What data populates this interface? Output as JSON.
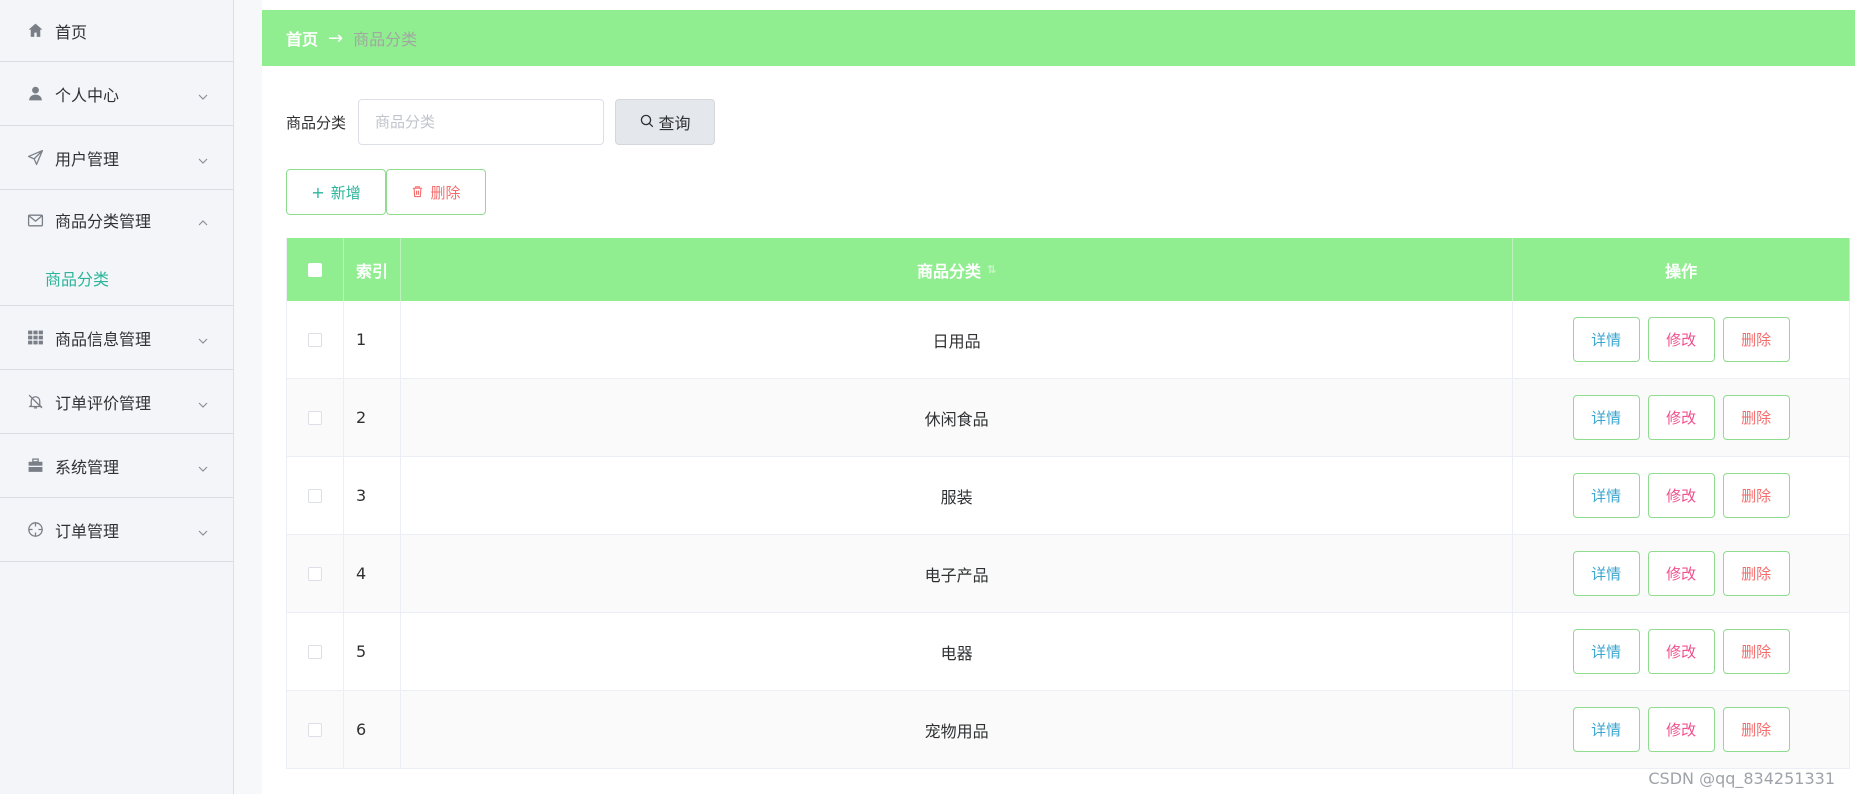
{
  "sidebar": {
    "items": [
      {
        "label": "首页",
        "icon": "home-icon"
      },
      {
        "label": "个人中心",
        "icon": "user-icon"
      },
      {
        "label": "用户管理",
        "icon": "send-icon"
      },
      {
        "label": "商品分类管理",
        "icon": "mail-icon",
        "expanded": true,
        "children": [
          {
            "label": "商品分类",
            "active": true
          }
        ]
      },
      {
        "label": "商品信息管理",
        "icon": "grid-icon"
      },
      {
        "label": "订单评价管理",
        "icon": "bell-off-icon"
      },
      {
        "label": "系统管理",
        "icon": "briefcase-icon"
      },
      {
        "label": "订单管理",
        "icon": "target-icon"
      }
    ]
  },
  "breadcrumb": {
    "home": "首页",
    "separator": "→",
    "current": "商品分类"
  },
  "search": {
    "label": "商品分类",
    "placeholder": "商品分类",
    "value": "",
    "button_label": "查询"
  },
  "actions": {
    "add_label": "新增",
    "delete_label": "删除"
  },
  "table": {
    "columns": {
      "index": "索引",
      "name": "商品分类",
      "ops": "操作"
    },
    "rows": [
      {
        "index": "1",
        "name": "日用品"
      },
      {
        "index": "2",
        "name": "休闲食品"
      },
      {
        "index": "3",
        "name": "服装"
      },
      {
        "index": "4",
        "name": "电子产品"
      },
      {
        "index": "5",
        "name": "电器"
      },
      {
        "index": "6",
        "name": "宠物用品"
      }
    ],
    "op_labels": {
      "detail": "详情",
      "edit": "修改",
      "delete": "删除"
    }
  },
  "watermark": "CSDN @qq_834251331",
  "colors": {
    "accent_green": "#90ee90",
    "teal_text": "#2bb59b",
    "danger": "#f56c6c"
  }
}
